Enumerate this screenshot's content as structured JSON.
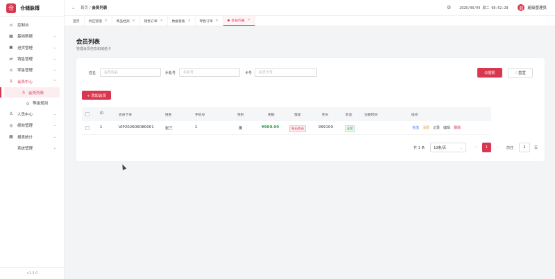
{
  "app": {
    "logo_char": "仓",
    "name": "仓储脉搏",
    "version": "v1.3.0"
  },
  "sidebar": {
    "items": [
      {
        "icon": "⌂",
        "label": "控制台",
        "chev": ""
      },
      {
        "icon": "▦",
        "label": "基础数据",
        "chev": "⌄"
      },
      {
        "icon": "▣",
        "label": "进货管理",
        "chev": "⌄"
      },
      {
        "icon": "⇄",
        "label": "销售管理",
        "chev": "⌄"
      },
      {
        "icon": "⌂",
        "label": "零售管理",
        "chev": "⌄"
      },
      {
        "icon": "♙",
        "label": "会员中心",
        "chev": "⌃"
      }
    ],
    "sub_items": [
      {
        "icon": "♙",
        "label": "会员列表"
      },
      {
        "icon": "⌂",
        "label": "等级规则"
      }
    ],
    "items_after": [
      {
        "icon": "♙",
        "label": "人员中心",
        "chev": "⌄"
      },
      {
        "icon": "◎",
        "label": "绩效管理",
        "chev": "⌄"
      },
      {
        "icon": "▦",
        "label": "报表统计",
        "chev": "⌄"
      },
      {
        "icon": "",
        "label": "系统管理",
        "chev": "⌄"
      }
    ]
  },
  "topbar": {
    "collapse_icon": "⌄",
    "crumb_home": "首页",
    "crumb_sep": "/",
    "crumb_current": "会员列表",
    "settings_icon": "⚙",
    "datetime": "2026/06/09 周二 08:52:28",
    "avatar_char": "超",
    "username": "超级管理员"
  },
  "tabs": [
    {
      "label": "首页",
      "closable": false
    },
    {
      "label": "供应管理",
      "closable": true
    },
    {
      "label": "商品档案",
      "closable": true
    },
    {
      "label": "销售订单",
      "closable": true
    },
    {
      "label": "数据看板",
      "closable": true
    },
    {
      "label": "零售订单",
      "closable": true
    },
    {
      "label": "会员列表",
      "closable": true,
      "active": true
    }
  ],
  "page": {
    "title": "会员列表",
    "subtitle": "管理会员信息和储值卡"
  },
  "filters": {
    "name_label": "姓名",
    "name_placeholder": "会员姓名",
    "phone_label": "手机号",
    "phone_placeholder": "手机号",
    "card_label": "卡号",
    "card_placeholder": "会员卡号",
    "search_label": "Q搜索",
    "reset_label": "♢重置"
  },
  "add_button": "+ 添加会员",
  "table": {
    "headers": [
      "ID",
      "会员卡号",
      "姓名",
      "手机号",
      "性别",
      "余额",
      "等级",
      "积分",
      "状态",
      "注册时间",
      "操作"
    ],
    "rows": [
      {
        "id": "1",
        "card": "VIP202606080001",
        "name": "张三",
        "phone": "1",
        "gender": "男",
        "balance": "¥900.00",
        "level": "钻石会员",
        "points": "999100",
        "status": "正常",
        "registered": "",
        "ops": [
          "充值",
          "消费",
          "记录",
          "编辑",
          "删除"
        ]
      }
    ]
  },
  "pagination": {
    "total": "共 1 条",
    "page_size": "10条/页",
    "prev": "‹",
    "current": "1",
    "next": "›",
    "goto_label": "前往",
    "goto_value": "1",
    "page_suffix": "页"
  },
  "colors": {
    "accent": "#d9364f",
    "success": "#2a9d4a",
    "warning": "#e6a23c",
    "link": "#3b82f6"
  }
}
